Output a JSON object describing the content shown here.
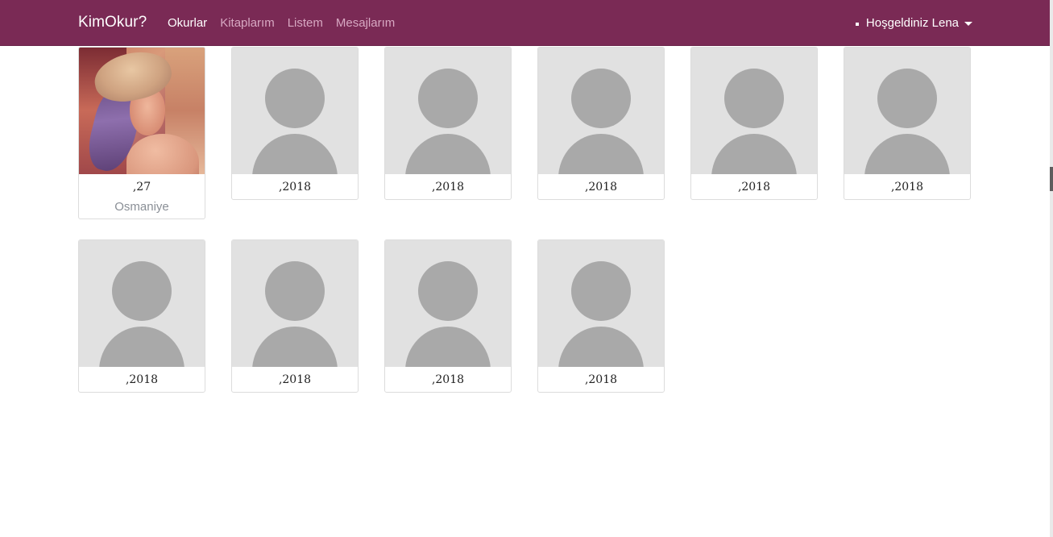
{
  "navbar": {
    "brand": "KimOkur?",
    "links": [
      {
        "label": "Okurlar",
        "active": true
      },
      {
        "label": "Kitaplarım",
        "active": false
      },
      {
        "label": "Listem",
        "active": false
      },
      {
        "label": "Mesajlarım",
        "active": false
      }
    ],
    "user_menu_label": "Hoşgeldiniz Lena"
  },
  "colors": {
    "navbar_bg": "#7a2a55",
    "placeholder_bg": "#e1e1e1",
    "avatar_gray": "#a9a9a9"
  },
  "readers": [
    {
      "photo": "portrait",
      "value": ",27",
      "city": "Osmaniye"
    },
    {
      "photo": "default-avatar",
      "value": ",2018"
    },
    {
      "photo": "default-avatar",
      "value": ",2018"
    },
    {
      "photo": "default-avatar",
      "value": ",2018"
    },
    {
      "photo": "default-avatar",
      "value": ",2018"
    },
    {
      "photo": "default-avatar",
      "value": ",2018"
    },
    {
      "photo": "default-avatar",
      "value": ",2018"
    },
    {
      "photo": "default-avatar",
      "value": ",2018"
    },
    {
      "photo": "default-avatar",
      "value": ",2018"
    },
    {
      "photo": "default-avatar",
      "value": ",2018"
    }
  ]
}
